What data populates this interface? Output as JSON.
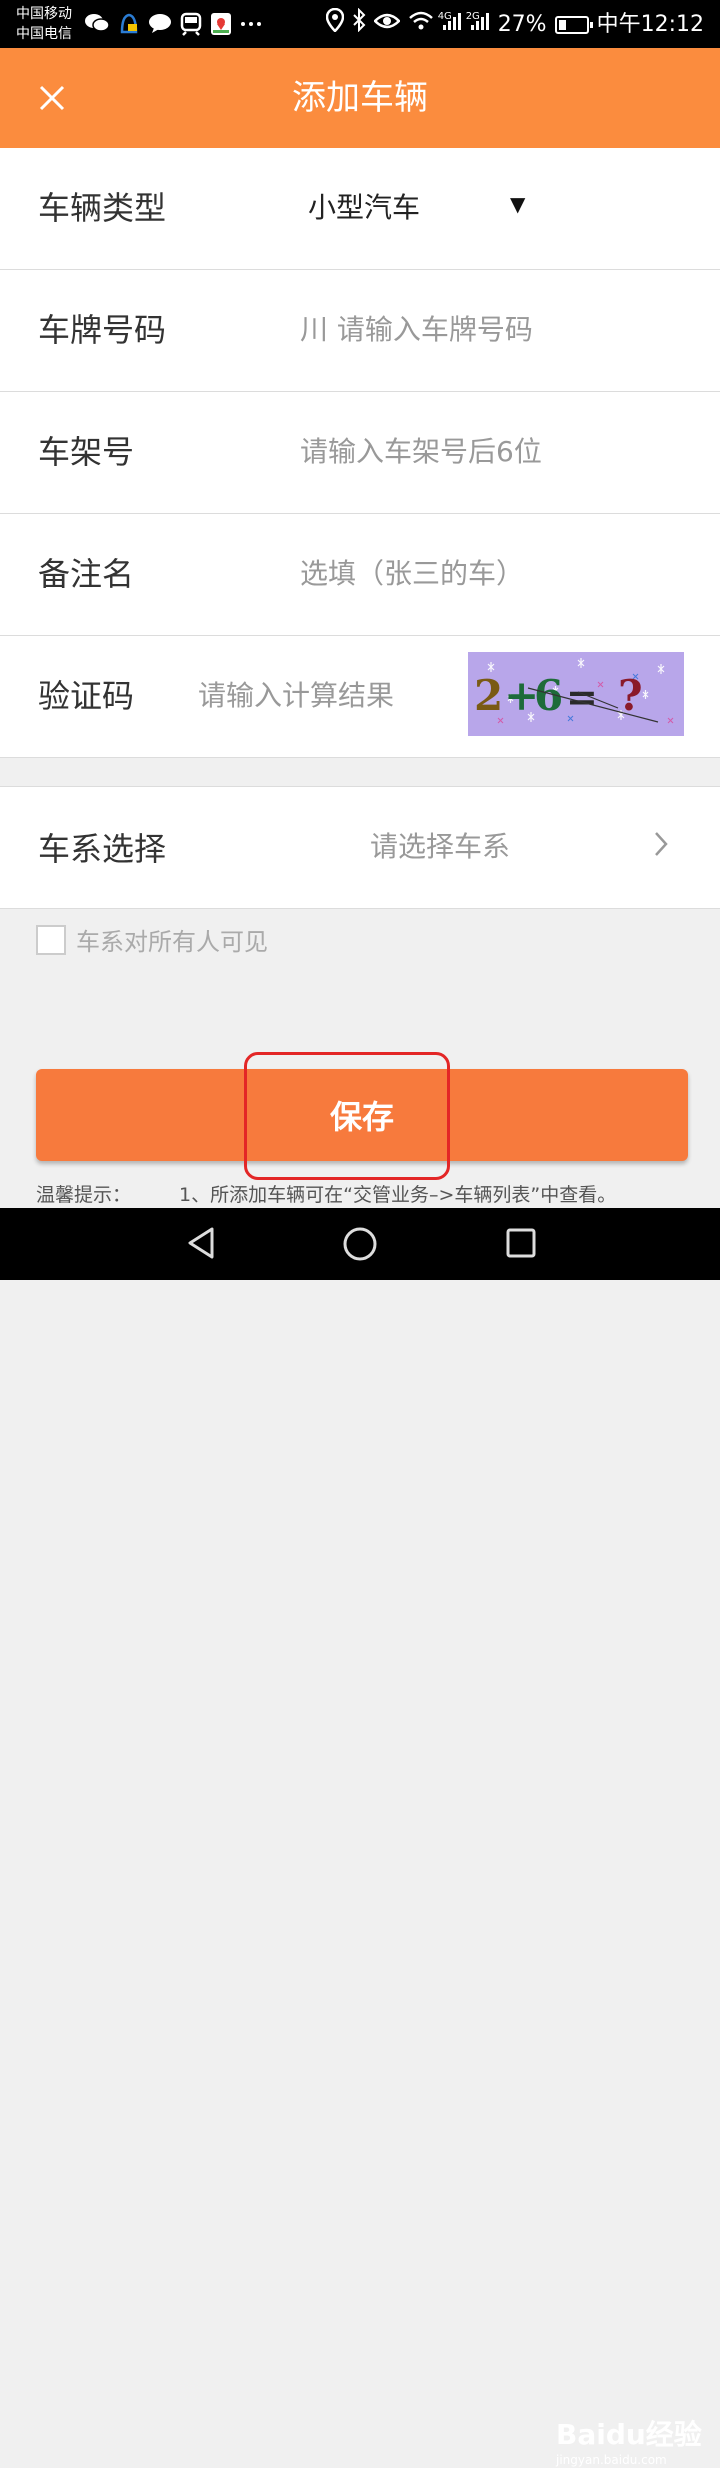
{
  "status_bar": {
    "carrier1": "中国移动",
    "carrier2": "中国电信",
    "network_4g": "4G",
    "network_2g": "2G",
    "battery": "27%",
    "battery_level": 0.27,
    "time": "中午12:12",
    "app_icons": [
      "wechat-icon",
      "qq-icon",
      "message-icon",
      "train-icon",
      "map-icon",
      "more-icon"
    ],
    "system_icons": [
      "location-icon",
      "bluetooth-icon",
      "eye-icon",
      "wifi-icon",
      "signal-icon",
      "battery-icon"
    ]
  },
  "app_bar": {
    "title": "添加车辆",
    "close_icon": "close-icon",
    "color": "#fb8c3e"
  },
  "form": {
    "vehicle_type": {
      "label": "车辆类型",
      "value": "小型汽车"
    },
    "plate": {
      "label": "车牌号码",
      "placeholder": "川 请输入车牌号码"
    },
    "frame": {
      "label": "车架号",
      "placeholder": "请输入车架号后6位"
    },
    "note": {
      "label": "备注名",
      "placeholder": "选填（张三的车）"
    },
    "captcha": {
      "label": "验证码",
      "placeholder": "请输入计算结果",
      "image_text": "2+6=?"
    }
  },
  "series": {
    "label": "车系选择",
    "placeholder": "请选择车系"
  },
  "visibility": {
    "label": "车系对所有人可见",
    "checked": false
  },
  "save_button": {
    "label": "保存",
    "color": "#f77a3d"
  },
  "hint": {
    "label": "温馨提示：",
    "text": "1、所添加车辆可在“交管业务–>车辆列表”中查看。"
  },
  "watermark": {
    "logo": "Baidu经验",
    "url": "jingyan.baidu.com"
  }
}
